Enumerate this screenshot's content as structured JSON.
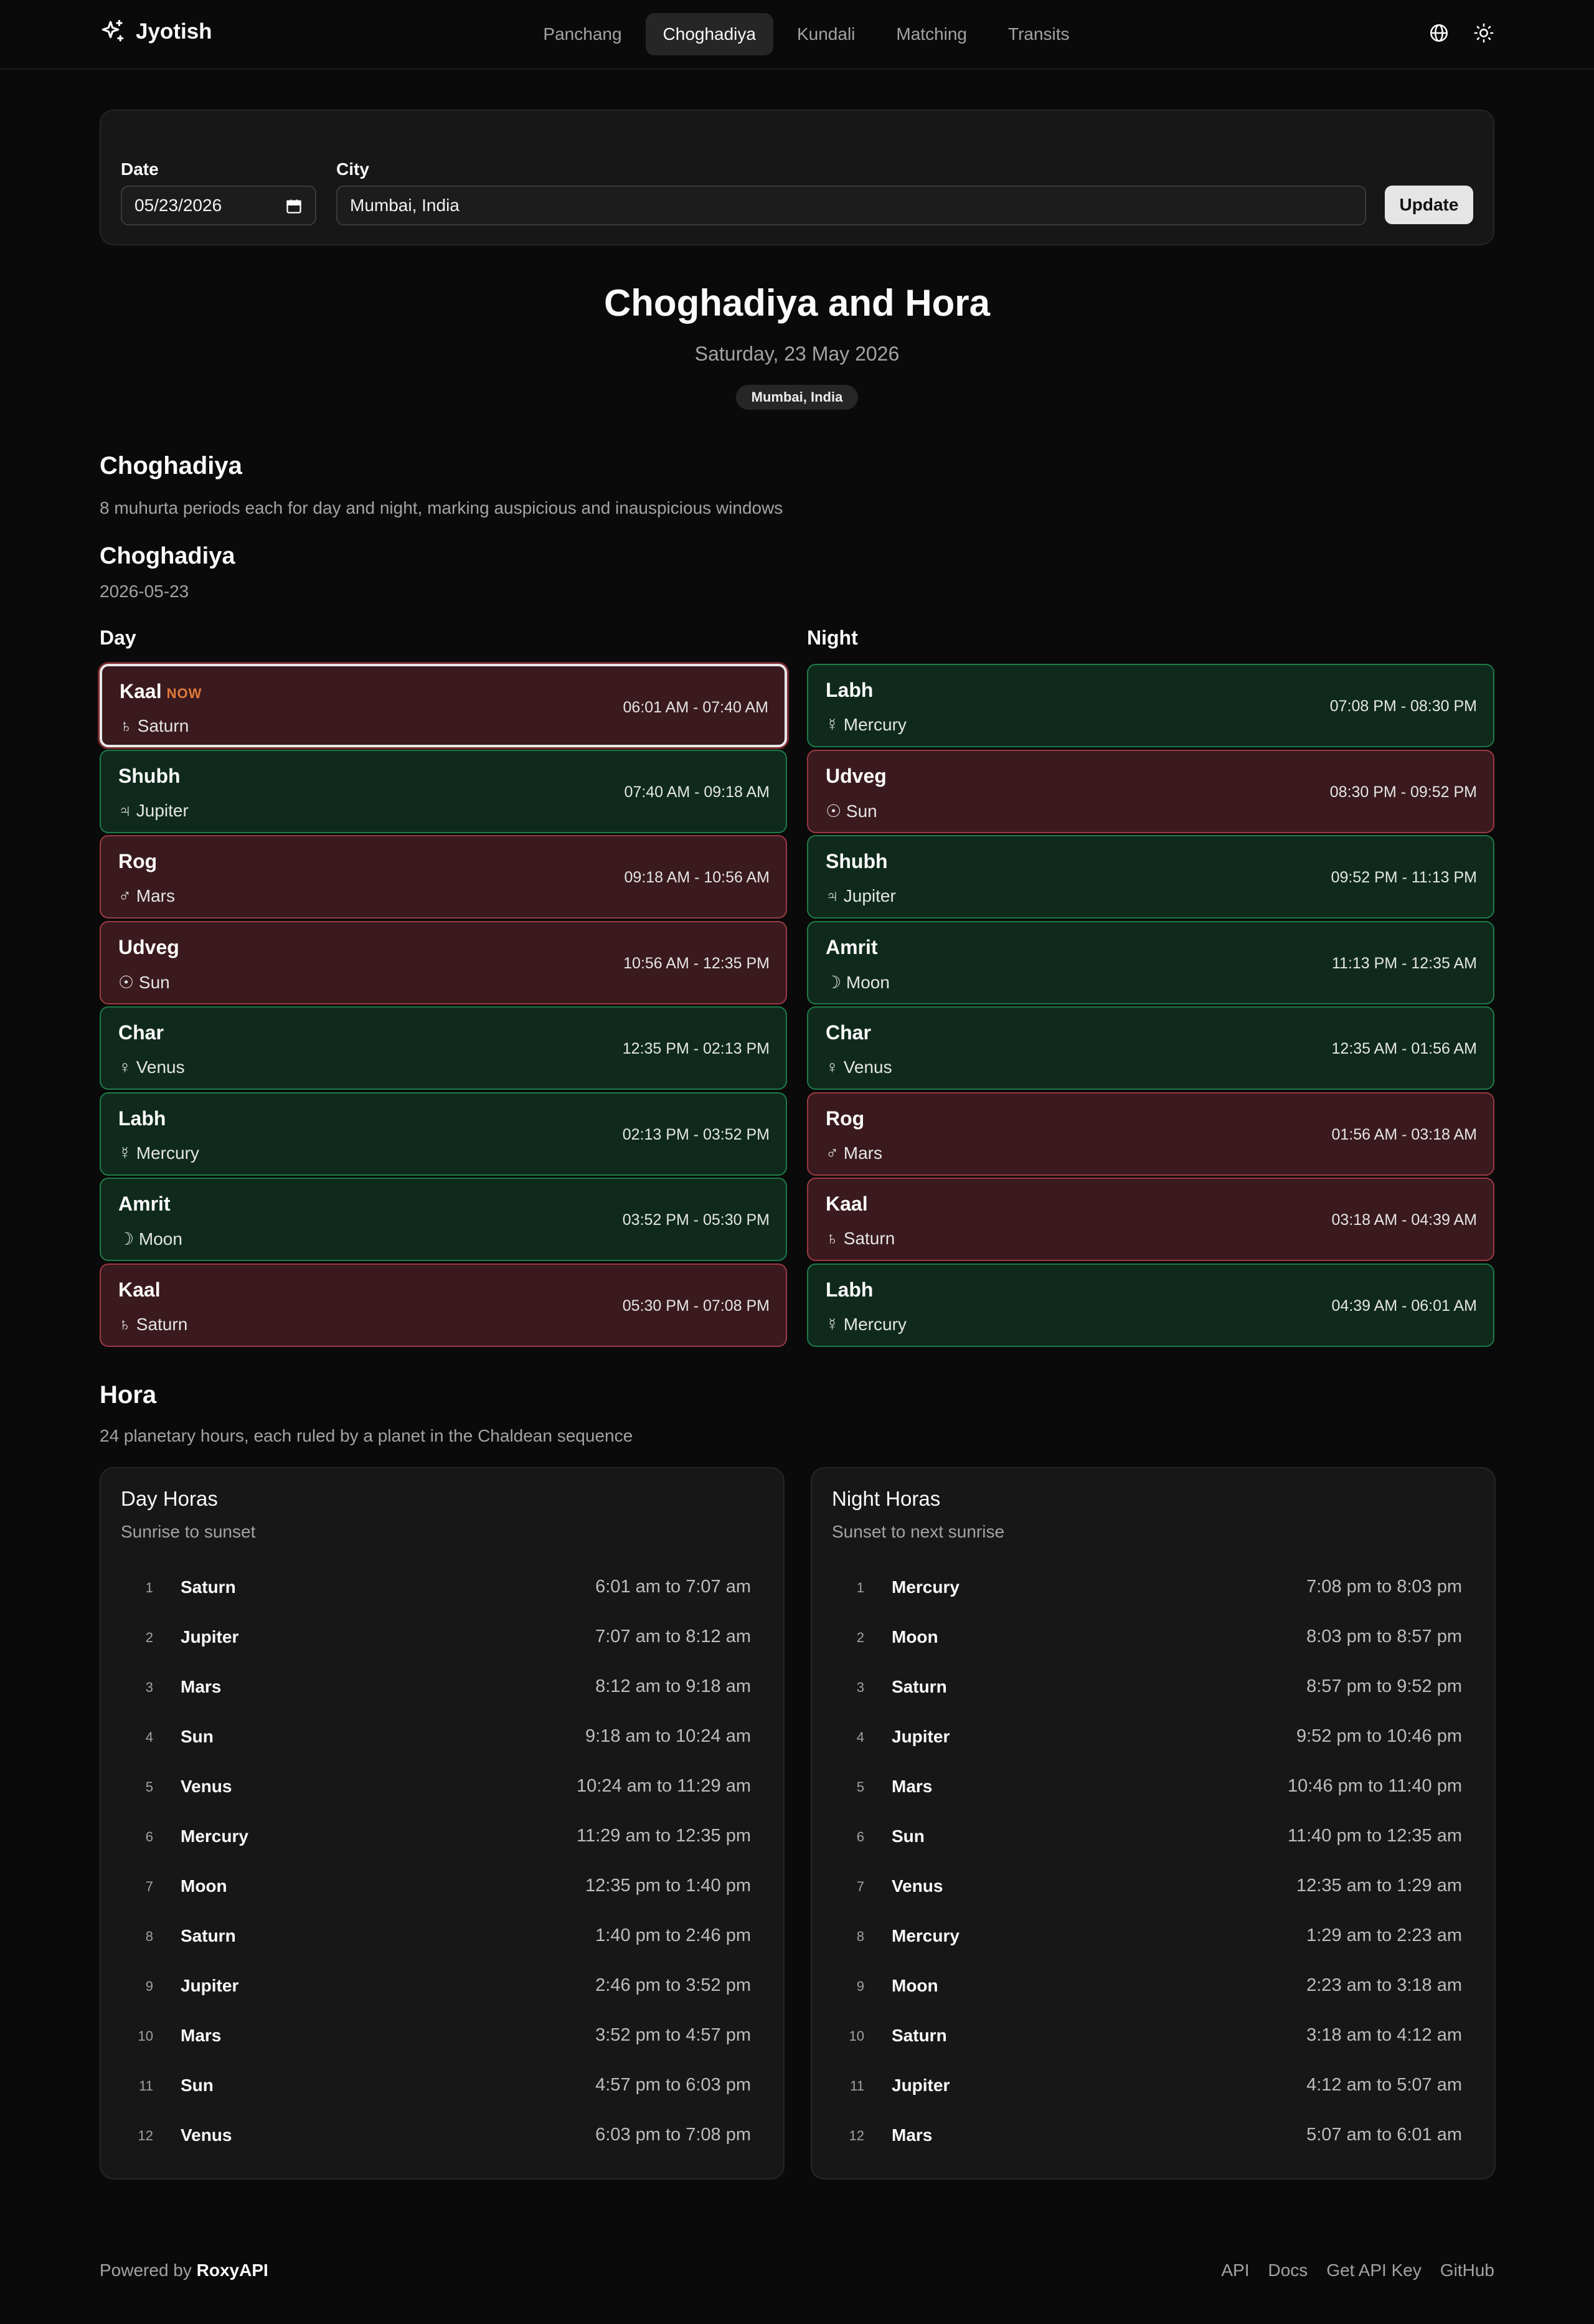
{
  "brand": {
    "name": "Jyotish"
  },
  "nav": [
    {
      "label": "Panchang",
      "active": false
    },
    {
      "label": "Choghadiya",
      "active": true
    },
    {
      "label": "Kundali",
      "active": false
    },
    {
      "label": "Matching",
      "active": false
    },
    {
      "label": "Transits",
      "active": false
    }
  ],
  "header_icons": [
    "globe-icon",
    "sun-icon"
  ],
  "form": {
    "date_label": "Date",
    "date_value": "05/23/2026",
    "city_label": "City",
    "city_value": "Mumbai, India",
    "update_label": "Update"
  },
  "page": {
    "title": "Choghadiya and Hora",
    "subtitle": "Saturday, 23 May 2026",
    "city_badge": "Mumbai, India"
  },
  "choghadiya": {
    "heading": "Choghadiya",
    "description": "8 muhurta periods each for day and night, marking auspicious and inauspicious windows",
    "subheading": "Choghadiya",
    "date": "2026-05-23",
    "day_label": "Day",
    "night_label": "Night",
    "now_label": "NOW",
    "day": [
      {
        "name": "Kaal",
        "symbol": "♄",
        "planet": "Saturn",
        "time": "06:01 AM - 07:40 AM",
        "quality": "bad",
        "current": true
      },
      {
        "name": "Shubh",
        "symbol": "♃",
        "planet": "Jupiter",
        "time": "07:40 AM - 09:18 AM",
        "quality": "good",
        "current": false
      },
      {
        "name": "Rog",
        "symbol": "♂",
        "planet": "Mars",
        "time": "09:18 AM - 10:56 AM",
        "quality": "bad",
        "current": false
      },
      {
        "name": "Udveg",
        "symbol": "☉",
        "planet": "Sun",
        "time": "10:56 AM - 12:35 PM",
        "quality": "bad",
        "current": false
      },
      {
        "name": "Char",
        "symbol": "♀",
        "planet": "Venus",
        "time": "12:35 PM - 02:13 PM",
        "quality": "good",
        "current": false
      },
      {
        "name": "Labh",
        "symbol": "☿",
        "planet": "Mercury",
        "time": "02:13 PM - 03:52 PM",
        "quality": "good",
        "current": false
      },
      {
        "name": "Amrit",
        "symbol": "☽",
        "planet": "Moon",
        "time": "03:52 PM - 05:30 PM",
        "quality": "good",
        "current": false
      },
      {
        "name": "Kaal",
        "symbol": "♄",
        "planet": "Saturn",
        "time": "05:30 PM - 07:08 PM",
        "quality": "bad",
        "current": false
      }
    ],
    "night": [
      {
        "name": "Labh",
        "symbol": "☿",
        "planet": "Mercury",
        "time": "07:08 PM - 08:30 PM",
        "quality": "good",
        "current": false
      },
      {
        "name": "Udveg",
        "symbol": "☉",
        "planet": "Sun",
        "time": "08:30 PM - 09:52 PM",
        "quality": "bad",
        "current": false
      },
      {
        "name": "Shubh",
        "symbol": "♃",
        "planet": "Jupiter",
        "time": "09:52 PM - 11:13 PM",
        "quality": "good",
        "current": false
      },
      {
        "name": "Amrit",
        "symbol": "☽",
        "planet": "Moon",
        "time": "11:13 PM - 12:35 AM",
        "quality": "good",
        "current": false
      },
      {
        "name": "Char",
        "symbol": "♀",
        "planet": "Venus",
        "time": "12:35 AM - 01:56 AM",
        "quality": "good",
        "current": false
      },
      {
        "name": "Rog",
        "symbol": "♂",
        "planet": "Mars",
        "time": "01:56 AM - 03:18 AM",
        "quality": "bad",
        "current": false
      },
      {
        "name": "Kaal",
        "symbol": "♄",
        "planet": "Saturn",
        "time": "03:18 AM - 04:39 AM",
        "quality": "bad",
        "current": false
      },
      {
        "name": "Labh",
        "symbol": "☿",
        "planet": "Mercury",
        "time": "04:39 AM - 06:01 AM",
        "quality": "good",
        "current": false
      }
    ]
  },
  "hora": {
    "heading": "Hora",
    "description": "24 planetary hours, each ruled by a planet in the Chaldean sequence",
    "day": {
      "title": "Day Horas",
      "subtitle": "Sunrise to sunset",
      "rows": [
        {
          "num": "1",
          "planet": "Saturn",
          "time": "6:01 am to 7:07 am"
        },
        {
          "num": "2",
          "planet": "Jupiter",
          "time": "7:07 am to 8:12 am"
        },
        {
          "num": "3",
          "planet": "Mars",
          "time": "8:12 am to 9:18 am"
        },
        {
          "num": "4",
          "planet": "Sun",
          "time": "9:18 am to 10:24 am"
        },
        {
          "num": "5",
          "planet": "Venus",
          "time": "10:24 am to 11:29 am"
        },
        {
          "num": "6",
          "planet": "Mercury",
          "time": "11:29 am to 12:35 pm"
        },
        {
          "num": "7",
          "planet": "Moon",
          "time": "12:35 pm to 1:40 pm"
        },
        {
          "num": "8",
          "planet": "Saturn",
          "time": "1:40 pm to 2:46 pm"
        },
        {
          "num": "9",
          "planet": "Jupiter",
          "time": "2:46 pm to 3:52 pm"
        },
        {
          "num": "10",
          "planet": "Mars",
          "time": "3:52 pm to 4:57 pm"
        },
        {
          "num": "11",
          "planet": "Sun",
          "time": "4:57 pm to 6:03 pm"
        },
        {
          "num": "12",
          "planet": "Venus",
          "time": "6:03 pm to 7:08 pm"
        }
      ]
    },
    "night": {
      "title": "Night Horas",
      "subtitle": "Sunset to next sunrise",
      "rows": [
        {
          "num": "1",
          "planet": "Mercury",
          "time": "7:08 pm to 8:03 pm"
        },
        {
          "num": "2",
          "planet": "Moon",
          "time": "8:03 pm to 8:57 pm"
        },
        {
          "num": "3",
          "planet": "Saturn",
          "time": "8:57 pm to 9:52 pm"
        },
        {
          "num": "4",
          "planet": "Jupiter",
          "time": "9:52 pm to 10:46 pm"
        },
        {
          "num": "5",
          "planet": "Mars",
          "time": "10:46 pm to 11:40 pm"
        },
        {
          "num": "6",
          "planet": "Sun",
          "time": "11:40 pm to 12:35 am"
        },
        {
          "num": "7",
          "planet": "Venus",
          "time": "12:35 am to 1:29 am"
        },
        {
          "num": "8",
          "planet": "Mercury",
          "time": "1:29 am to 2:23 am"
        },
        {
          "num": "9",
          "planet": "Moon",
          "time": "2:23 am to 3:18 am"
        },
        {
          "num": "10",
          "planet": "Saturn",
          "time": "3:18 am to 4:12 am"
        },
        {
          "num": "11",
          "planet": "Jupiter",
          "time": "4:12 am to 5:07 am"
        },
        {
          "num": "12",
          "planet": "Mars",
          "time": "5:07 am to 6:01 am"
        }
      ]
    }
  },
  "footer": {
    "powered_prefix": "Powered by",
    "powered_brand": "RoxyAPI",
    "links": [
      "API",
      "Docs",
      "Get API Key",
      "GitHub"
    ]
  },
  "colors": {
    "background": "#0a0a0a",
    "good_bg": "#0f2a1d",
    "good_border": "#1f7a47",
    "bad_bg": "#3a1a1e",
    "bad_border": "#9a3a42",
    "now_accent": "#e07a3a"
  }
}
